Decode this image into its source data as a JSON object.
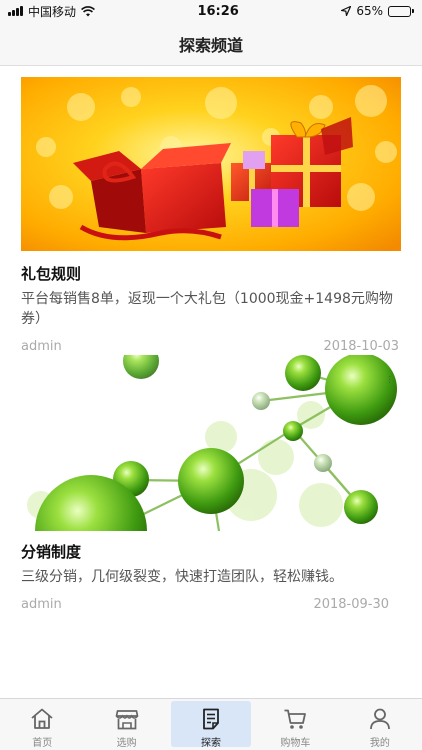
{
  "status_bar": {
    "carrier": "中国移动",
    "time": "16:26",
    "battery": "65%",
    "battery_level": 0.65
  },
  "nav": {
    "title": "探索频道"
  },
  "articles": [
    {
      "title": "礼包规则",
      "summary": "平台每销售8单，返现一个大礼包（1000现金+1498元购物券）",
      "author": "admin",
      "date": "2018-10-03"
    },
    {
      "title": "分销制度",
      "summary": "三级分销，几何级裂变，快速打造团队，轻松赚钱。",
      "author": "admin",
      "date": "2018-09-30"
    }
  ],
  "tab_bar": {
    "items": [
      {
        "label": "首页",
        "icon": "home-icon"
      },
      {
        "label": "选购",
        "icon": "store-icon"
      },
      {
        "label": "探索",
        "icon": "explore-icon",
        "active": true
      },
      {
        "label": "购物车",
        "icon": "cart-icon"
      },
      {
        "label": "我的",
        "icon": "user-icon"
      }
    ]
  },
  "colors": {
    "active_tab_bg": "#d8e6f8",
    "nav_bg": "#f7f7f7",
    "meta_text": "#aaaaaa"
  }
}
